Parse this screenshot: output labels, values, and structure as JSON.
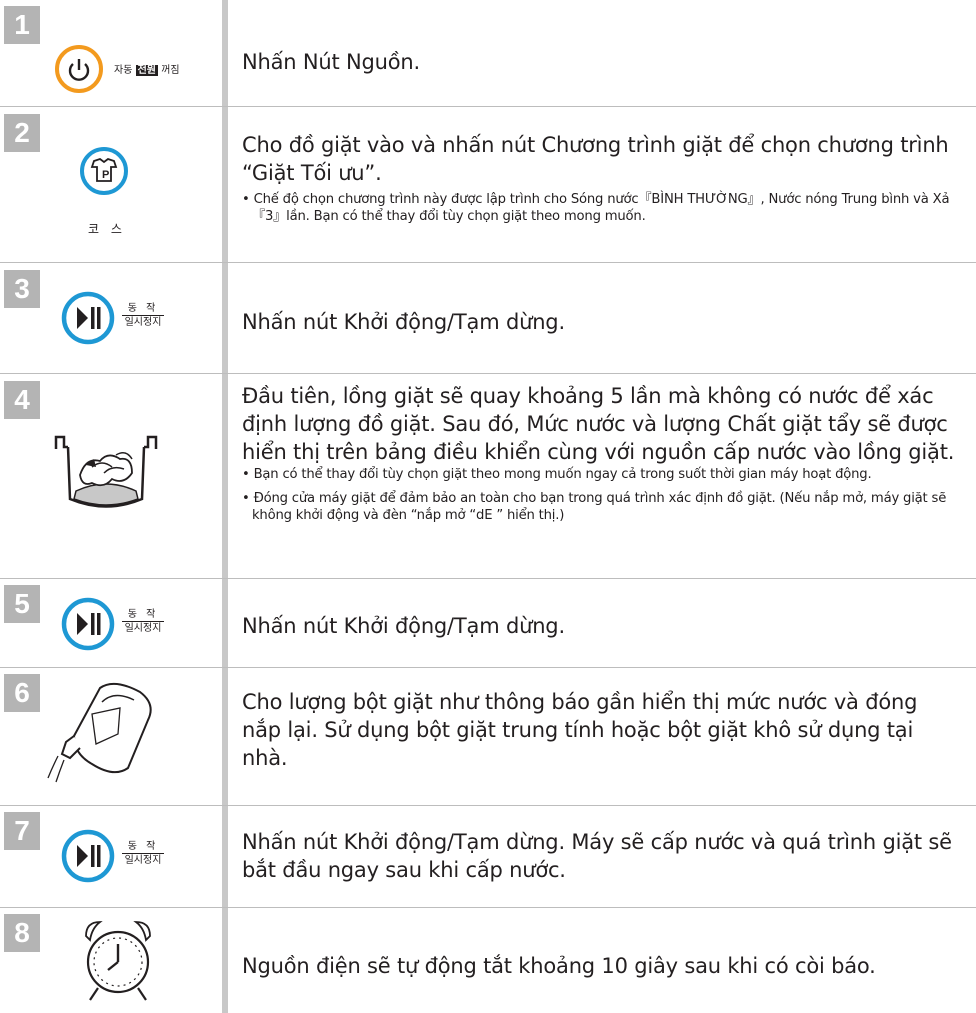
{
  "steps": [
    {
      "num": "1",
      "main": "Nhấn Nút Nguồn.",
      "notes": [],
      "icon": "power-button-icon",
      "icon_labels": {
        "left": "자동",
        "box": "전원",
        "right": "꺼짐"
      }
    },
    {
      "num": "2",
      "main": "Cho đồ giặt vào và nhấn nút Chương trình giặt để chọn chương trình “Giặt Tối ưu”.",
      "notes": [
        "• Chế độ chọn chương trình này được lập trình cho Sóng nước『BÌNH THƯỜNG』, Nước nóng Trung bình và Xả『3』lần. Bạn có thể thay đổi tùy chọn giặt theo mong muốn."
      ],
      "icon": "course-button-icon",
      "icon_labels": {
        "caption": "코 스"
      }
    },
    {
      "num": "3",
      "main": "Nhấn nút Khởi động/Tạm dừng.",
      "notes": [],
      "icon": "play-pause-button-icon",
      "icon_labels": {
        "top": "동 작",
        "bottom": "일시정지"
      }
    },
    {
      "num": "4",
      "main": "Đầu tiên, lồng giặt sẽ quay khoảng 5 lần mà không có nước để xác định lượng đồ giặt. Sau đó, Mức nước và lượng Chất giặt tẩy sẽ được hiển thị trên bảng điều khiển cùng với nguồn cấp nước vào lồng giặt.",
      "notes": [
        "• Bạn có thể thay đổi tùy chọn giặt theo mong muốn ngay cả trong suốt thời gian máy hoạt động.",
        "• Đóng cửa máy giặt để đảm bảo an toàn cho bạn trong quá trình xác định đồ giặt. (Nếu nắp mở, máy giặt sẽ không khởi động và đèn “nắp mở “dE ” hiển thị.)"
      ],
      "icon": "laundry-tub-icon"
    },
    {
      "num": "5",
      "main": "Nhấn nút Khởi động/Tạm dừng.",
      "notes": [],
      "icon": "play-pause-button-icon",
      "icon_labels": {
        "top": "동 작",
        "bottom": "일시정지"
      }
    },
    {
      "num": "6",
      "main": "Cho lượng bột giặt như thông báo gần hiển thị mức nước và đóng nắp lại. Sử dụng bột giặt trung tính hoặc bột giặt khô sử dụng tại nhà.",
      "notes": [],
      "icon": "detergent-bottle-icon"
    },
    {
      "num": "7",
      "main": "Nhấn nút Khởi động/Tạm dừng. Máy sẽ cấp nước và quá trình giặt sẽ bắt đầu ngay sau khi cấp nước.",
      "notes": [],
      "icon": "play-pause-button-icon",
      "icon_labels": {
        "top": "동 작",
        "bottom": "일시정지"
      }
    },
    {
      "num": "8",
      "main": "Nguồn điện sẽ tự động tắt khoảng 10 giây sau khi có còi báo.",
      "notes": [],
      "icon": "alarm-clock-icon"
    }
  ],
  "colors": {
    "orange": "#f39a1e",
    "blue": "#1e98d4",
    "badge": "#b4b4b4",
    "divider": "#c8c8c8"
  }
}
